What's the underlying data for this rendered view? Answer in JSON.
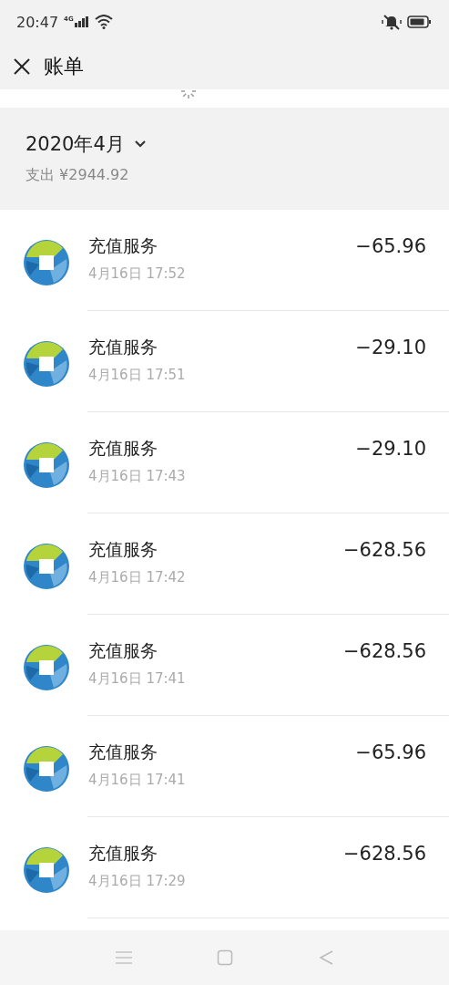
{
  "status_bar": {
    "time": "20:47",
    "network": "4G"
  },
  "header": {
    "title": "账单"
  },
  "month": {
    "label": "2020年4月",
    "summary": "支出 ¥2944.92"
  },
  "transactions": [
    {
      "title": "充值服务",
      "time": "4月16日 17:52",
      "amount": "−65.96"
    },
    {
      "title": "充值服务",
      "time": "4月16日 17:51",
      "amount": "−29.10"
    },
    {
      "title": "充值服务",
      "time": "4月16日 17:43",
      "amount": "−29.10"
    },
    {
      "title": "充值服务",
      "time": "4月16日 17:42",
      "amount": "−628.56"
    },
    {
      "title": "充值服务",
      "time": "4月16日 17:41",
      "amount": "−628.56"
    },
    {
      "title": "充值服务",
      "time": "4月16日 17:41",
      "amount": "−65.96"
    },
    {
      "title": "充值服务",
      "time": "4月16日 17:29",
      "amount": "−628.56"
    }
  ]
}
